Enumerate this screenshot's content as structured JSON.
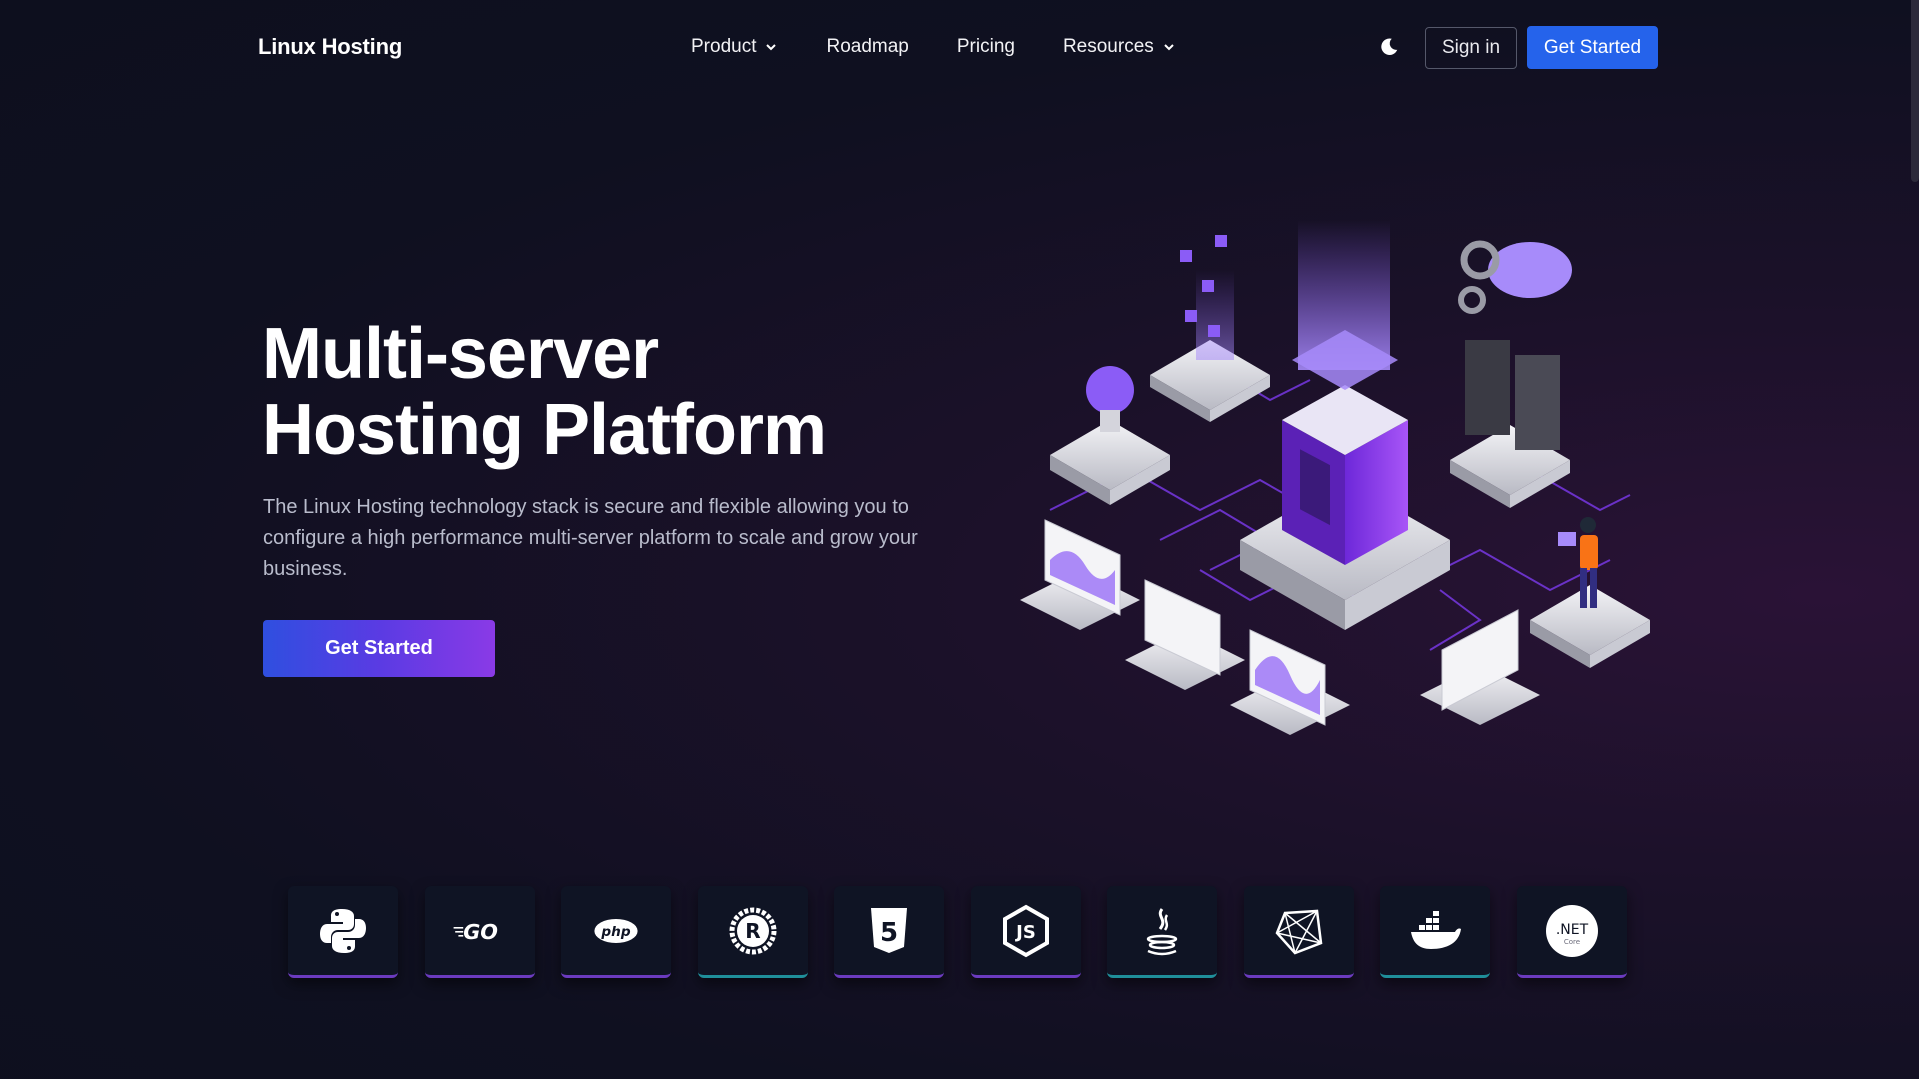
{
  "nav": {
    "brand": "Linux Hosting",
    "links": [
      {
        "label": "Product",
        "has_dropdown": true
      },
      {
        "label": "Roadmap",
        "has_dropdown": false
      },
      {
        "label": "Pricing",
        "has_dropdown": false
      },
      {
        "label": "Resources",
        "has_dropdown": true
      }
    ],
    "theme_icon": "moon-icon",
    "sign_in": "Sign in",
    "get_started": "Get Started"
  },
  "hero": {
    "title_line1": "Multi-server",
    "title_line2": "Hosting Platform",
    "description": "The Linux Hosting technology stack is secure and flexible allowing you to configure a high performance multi-server platform to scale and grow your business.",
    "cta": "Get Started"
  },
  "tech_stack": [
    {
      "name": "python-icon"
    },
    {
      "name": "go-icon",
      "label": "GO"
    },
    {
      "name": "php-icon",
      "label": "php"
    },
    {
      "name": "rust-icon",
      "label": "R"
    },
    {
      "name": "html5-icon",
      "label": "5"
    },
    {
      "name": "nodejs-icon",
      "label": "JS"
    },
    {
      "name": "java-icon"
    },
    {
      "name": "ruby-icon"
    },
    {
      "name": "docker-icon"
    },
    {
      "name": "dotnet-core-icon",
      "label": ".NET",
      "sublabel": "Core"
    }
  ],
  "colors": {
    "accent_blue": "#2563eb",
    "purple": "#8a3ae6",
    "teal": "#1f8f9a"
  }
}
